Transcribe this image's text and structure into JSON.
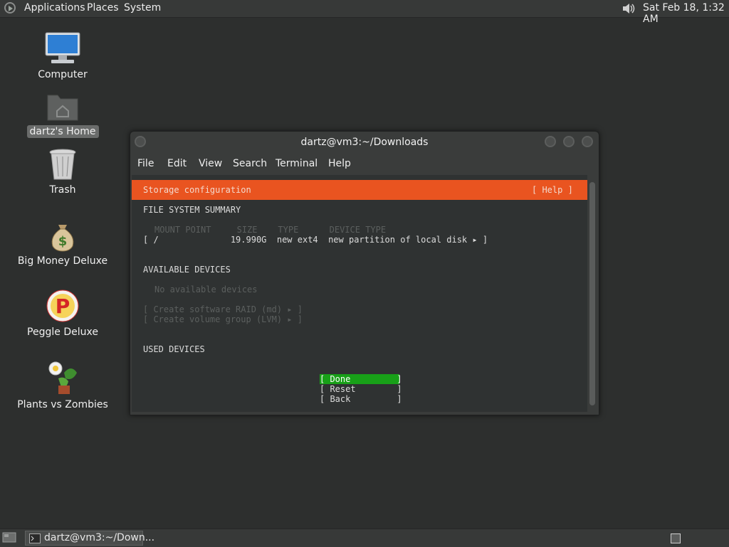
{
  "top_panel": {
    "menus": [
      "Applications",
      "Places",
      "System"
    ],
    "clock": "Sat Feb 18,  1:32 AM"
  },
  "desktop": {
    "icons": [
      {
        "label": "Computer",
        "icon": "computer-icon"
      },
      {
        "label": "dartz's Home",
        "icon": "home-folder-icon"
      },
      {
        "label": "Trash",
        "icon": "trash-icon"
      },
      {
        "label": "Big Money Deluxe",
        "icon": "money-bag-icon"
      },
      {
        "label": "Peggle Deluxe",
        "icon": "peggle-icon"
      },
      {
        "label": "Plants vs Zombies",
        "icon": "plants-vs-zombies-icon"
      }
    ]
  },
  "window": {
    "title": "dartz@vm3:~/Downloads",
    "menu": [
      "File",
      "Edit",
      "View",
      "Search",
      "Terminal",
      "Help"
    ]
  },
  "installer": {
    "header": "Storage configuration",
    "help": "[ Help ]",
    "fs_summary_title": "FILE SYSTEM SUMMARY",
    "fs_columns": "MOUNT POINT     SIZE    TYPE      DEVICE TYPE",
    "fs_row": "[ /              19.990G  new ext4  new partition of local disk ▸ ]",
    "available_title": "AVAILABLE DEVICES",
    "no_devices": "No available devices",
    "create_raid": "[ Create software RAID (md) ▸ ]",
    "create_lvm": "[ Create volume group (LVM) ▸ ]",
    "used_title": "USED DEVICES",
    "buttons": {
      "done": "[ Done         ]",
      "reset": "[ Reset        ]",
      "back": "[ Back         ]"
    }
  },
  "taskbar": {
    "task_label": "dartz@vm3:~/Down..."
  },
  "colors": {
    "accent_orange": "#e95420",
    "done_green": "#18a018"
  }
}
